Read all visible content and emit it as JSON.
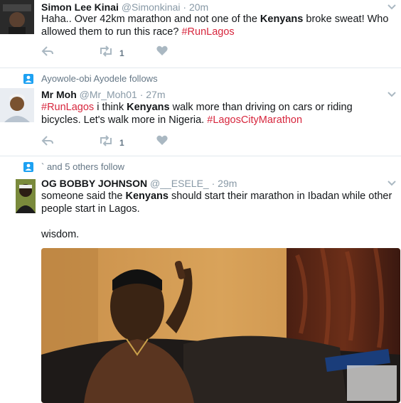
{
  "tweets": [
    {
      "name": "Simon Lee Kinai",
      "handle": "@Simonkinai",
      "dot": "·",
      "time": "20m",
      "text_parts": [
        "Haha.. Over 42km marathon and not one of the ",
        "Kenyans",
        " broke sweat! Who allowed them to run this race? ",
        "#RunLagos"
      ],
      "retweet_count": "1"
    },
    {
      "context": "Ayowole-obi Ayodele follows",
      "name": "Mr Moh",
      "handle": "@Mr_Moh01",
      "dot": "·",
      "time": "27m",
      "text_parts": [
        "#RunLagos",
        " i think ",
        "Kenyans",
        " walk more than driving on cars or riding bicycles. Let's walk more in Nigeria. ",
        "#LagosCityMarathon"
      ],
      "retweet_count": "1"
    },
    {
      "context": "` and 5 others follow",
      "name": "OG BOBBY JOHNSON",
      "handle": "@__ESELE_",
      "dot": "·",
      "time": "29m",
      "text_parts": [
        "someone said the ",
        "Kenyans",
        " should start their marathon in Ibadan while other people start in Lagos."
      ],
      "text_extra": "wisdom."
    }
  ],
  "colors": {
    "hashtag": "#d7263d",
    "meta": "#8899a6",
    "action": "#aab8c2",
    "context_icon": "#1da1f2"
  },
  "icons": [
    "reply-icon",
    "retweet-icon",
    "like-icon",
    "chevron-down-icon",
    "follow-context-icon"
  ]
}
